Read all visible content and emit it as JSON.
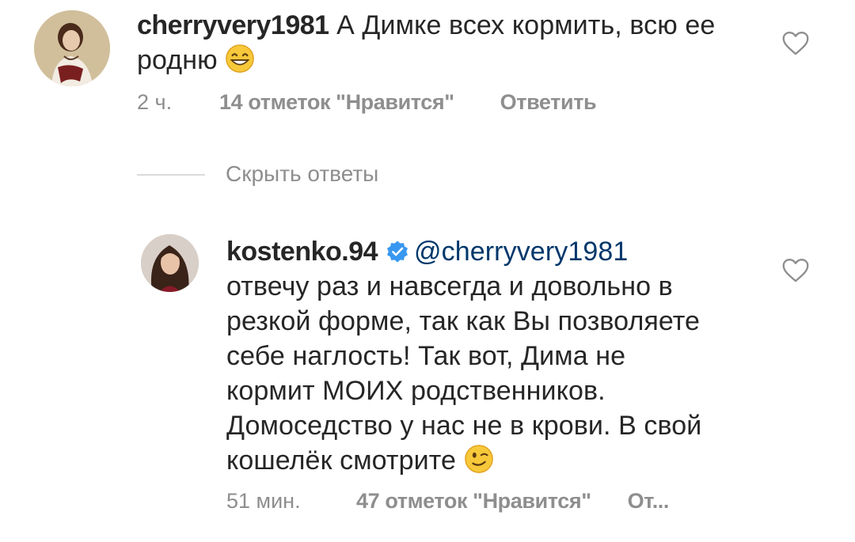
{
  "comment1": {
    "username": "cherryvery1981",
    "text": "А Димке всех кормить, всю ее родню",
    "emoji": "grinning-face-with-smiling-eyes",
    "time": "2 ч.",
    "likes": "14 отметок \"Нравится\"",
    "reply_label": "Ответить"
  },
  "replies_toggle": {
    "label": "Скрыть ответы"
  },
  "reply1": {
    "username": "kostenko.94",
    "verified": true,
    "mention": "@cherryvery1981",
    "lines": [
      "отвечу раз и навсегда и довольно в",
      "резкой форме, так как Вы позволяете",
      "себе наглость! Так вот,  Дима не",
      "кормит МОИХ родственников.",
      "Домоседство у нас не в крови. В свой",
      "кошелёк смотрите"
    ],
    "emoji": "winking-face",
    "time": "51 мин.",
    "likes": "47 отметок \"Нравится\"",
    "reply_label": "От..."
  },
  "colors": {
    "text": "#262626",
    "muted": "#8e8e8e",
    "mention": "#00376b",
    "verified": "#3897f0"
  }
}
